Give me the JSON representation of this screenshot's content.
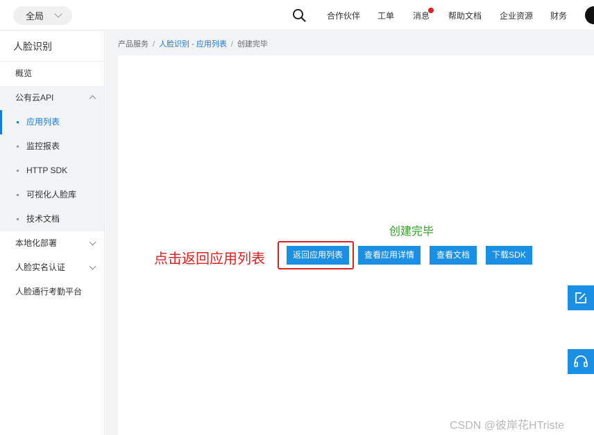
{
  "topbar": {
    "scope": "全局",
    "nav": [
      "合作伙伴",
      "工单",
      "消息",
      "帮助文档",
      "企业资源",
      "财务"
    ]
  },
  "sidebar": {
    "title": "人脸识别",
    "overview": "概览",
    "public_api": "公有云API",
    "sub_items": [
      "应用列表",
      "监控报表",
      "HTTP SDK",
      "可视化人脸库",
      "技术文档"
    ],
    "local_deploy": "本地化部署",
    "realname": "人脸实名认证",
    "attendance": "人脸通行考勤平台"
  },
  "breadcrumb": {
    "root": "产品服务",
    "link": "人脸识别 - 应用列表",
    "current": "创建完毕"
  },
  "main": {
    "done_title": "创建完毕",
    "annotation": "点击返回应用列表",
    "buttons": [
      "返回应用列表",
      "查看应用详情",
      "查看文档",
      "下载SDK"
    ]
  },
  "watermark": "CSDN @彼岸花HTriste"
}
